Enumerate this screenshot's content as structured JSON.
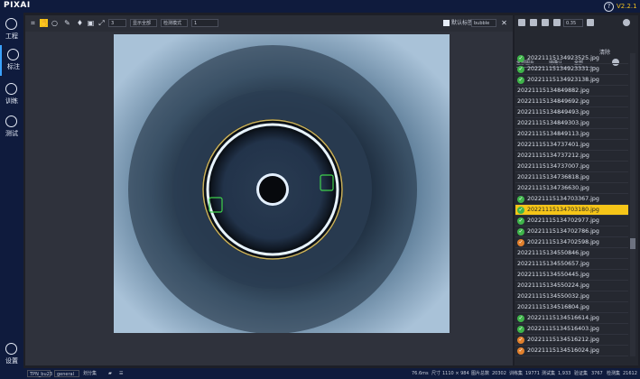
{
  "app": {
    "logo": "PIXAI",
    "version": "V2.2.1",
    "help_icon": "help-icon"
  },
  "nav": [
    {
      "label": "工程",
      "icon": "project-icon"
    },
    {
      "label": "标注",
      "icon": "annotate-icon"
    },
    {
      "label": "训练",
      "icon": "train-icon"
    },
    {
      "label": "测试",
      "icon": "test-icon"
    }
  ],
  "settings": {
    "label": "设置",
    "icon": "gear-icon"
  },
  "toolbar": {
    "size_value": "3",
    "select1": "显示全部",
    "select2": "检测模式",
    "num_value": "1",
    "check_label": "默认标签",
    "label_select": "bubble"
  },
  "right": {
    "zoom_value": "0.35",
    "clear_btn": "清除",
    "filter1": "全部图片",
    "filter2": "待确认",
    "filter3": "全部"
  },
  "files": [
    {
      "name": "20221115134923525.jpg",
      "status": "ok"
    },
    {
      "name": "20221115134923331.jpg",
      "status": "ok"
    },
    {
      "name": "20221115134923138.jpg",
      "status": "ok"
    },
    {
      "name": "20221115134849882.jpg",
      "status": ""
    },
    {
      "name": "20221115134849692.jpg",
      "status": ""
    },
    {
      "name": "20221115134849493.jpg",
      "status": ""
    },
    {
      "name": "20221115134849303.jpg",
      "status": ""
    },
    {
      "name": "20221115134849113.jpg",
      "status": ""
    },
    {
      "name": "20221115134737401.jpg",
      "status": ""
    },
    {
      "name": "20221115134737212.jpg",
      "status": ""
    },
    {
      "name": "20221115134737007.jpg",
      "status": ""
    },
    {
      "name": "20221115134736818.jpg",
      "status": ""
    },
    {
      "name": "20221115134736630.jpg",
      "status": ""
    },
    {
      "name": "20221115134703367.jpg",
      "status": "ok"
    },
    {
      "name": "20221115134703180.jpg",
      "status": "ok",
      "selected": true
    },
    {
      "name": "20221115134702977.jpg",
      "status": "ok"
    },
    {
      "name": "20221115134702786.jpg",
      "status": "ok"
    },
    {
      "name": "20221115134702598.jpg",
      "status": "warn"
    },
    {
      "name": "20221115134550846.jpg",
      "status": ""
    },
    {
      "name": "20221115134550657.jpg",
      "status": ""
    },
    {
      "name": "20221115134550445.jpg",
      "status": ""
    },
    {
      "name": "20221115134550224.jpg",
      "status": ""
    },
    {
      "name": "20221115134550032.jpg",
      "status": ""
    },
    {
      "name": "20221115134516804.jpg",
      "status": ""
    },
    {
      "name": "20221115134516614.jpg",
      "status": "ok"
    },
    {
      "name": "20221115134516403.jpg",
      "status": "ok"
    },
    {
      "name": "20221115134516212.jpg",
      "status": "warn"
    },
    {
      "name": "20221115134516024.jpg",
      "status": "warn"
    }
  ],
  "statusbar": {
    "field1": "TPN_bu23",
    "field2": "general",
    "split_label": "划分集",
    "fps": "76.6ms",
    "size_label": "尺寸",
    "size_value": "1110 × 984",
    "total_label": "图片总数",
    "total_value": "20302",
    "train_label": "训练集",
    "train_value": "19771",
    "test_label": "测试集",
    "test_value": "1,933",
    "verify_label": "验证集",
    "verify_value": "3767",
    "detect_label": "检测集",
    "detect_value": "21612"
  },
  "colors": {
    "accent": "#f5c518",
    "ok": "#3fb44a",
    "warn": "#e2802c",
    "nav_bg": "#0f1b3d"
  }
}
